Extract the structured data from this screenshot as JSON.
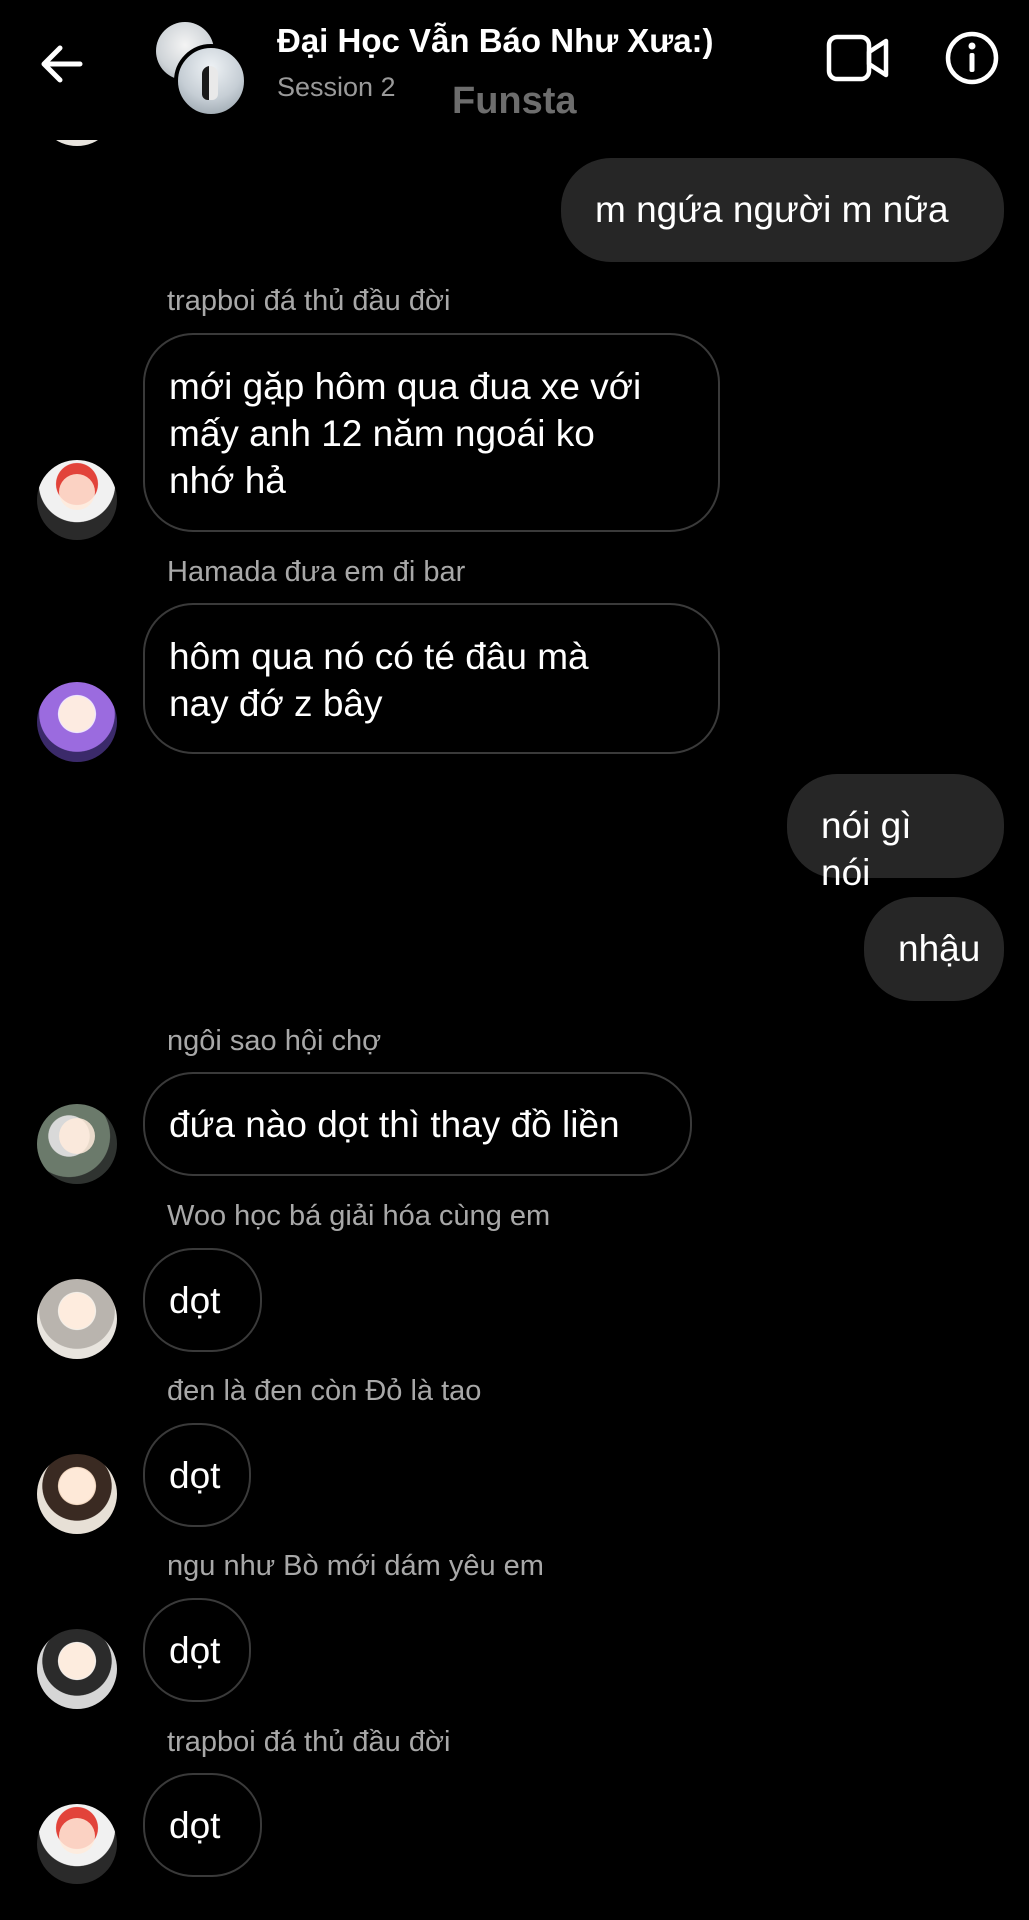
{
  "header": {
    "back_icon": "arrow-left-icon",
    "title": "Đại Học Vẫn Báo Như Xưa:)",
    "subtitle": "Session 2",
    "watermark": "Funsta",
    "video_icon": "video-camera-icon",
    "info_icon": "info-circle-icon"
  },
  "messages": [
    {
      "direction": "out",
      "text": "m ngứa người m nữa"
    },
    {
      "direction": "in",
      "sender": "trapboi đá thủ đầu đời",
      "lines": [
        "mới gặp hôm qua đua xe với",
        "mấy anh 12 năm ngoái ko",
        "nhớ hả"
      ]
    },
    {
      "direction": "in",
      "sender": "Hamada đưa em đi bar",
      "lines": [
        "hôm qua nó có té đâu mà",
        "nay đớ z bây"
      ]
    },
    {
      "direction": "out",
      "text": "nói gì nói"
    },
    {
      "direction": "out",
      "text": "nhậu"
    },
    {
      "direction": "in",
      "sender": "ngôi sao hội chợ",
      "text": "đứa nào dọt thì thay đồ liền"
    },
    {
      "direction": "in",
      "sender": "Woo học bá giải hóa cùng em",
      "text": "dọt"
    },
    {
      "direction": "in",
      "sender": "đen là đen còn Đỏ là tao",
      "text": "dọt"
    },
    {
      "direction": "in",
      "sender": "ngu như Bò mới dám yêu em",
      "text": "dọt"
    },
    {
      "direction": "in",
      "sender": "trapboi đá thủ đầu đời",
      "text": "dọt"
    }
  ],
  "colors": {
    "background": "#000000",
    "outgoing_bubble": "#262626",
    "incoming_border": "#3a3a3a",
    "sender_text": "#a8a8a8",
    "subtitle_text": "#9a9a9a"
  }
}
